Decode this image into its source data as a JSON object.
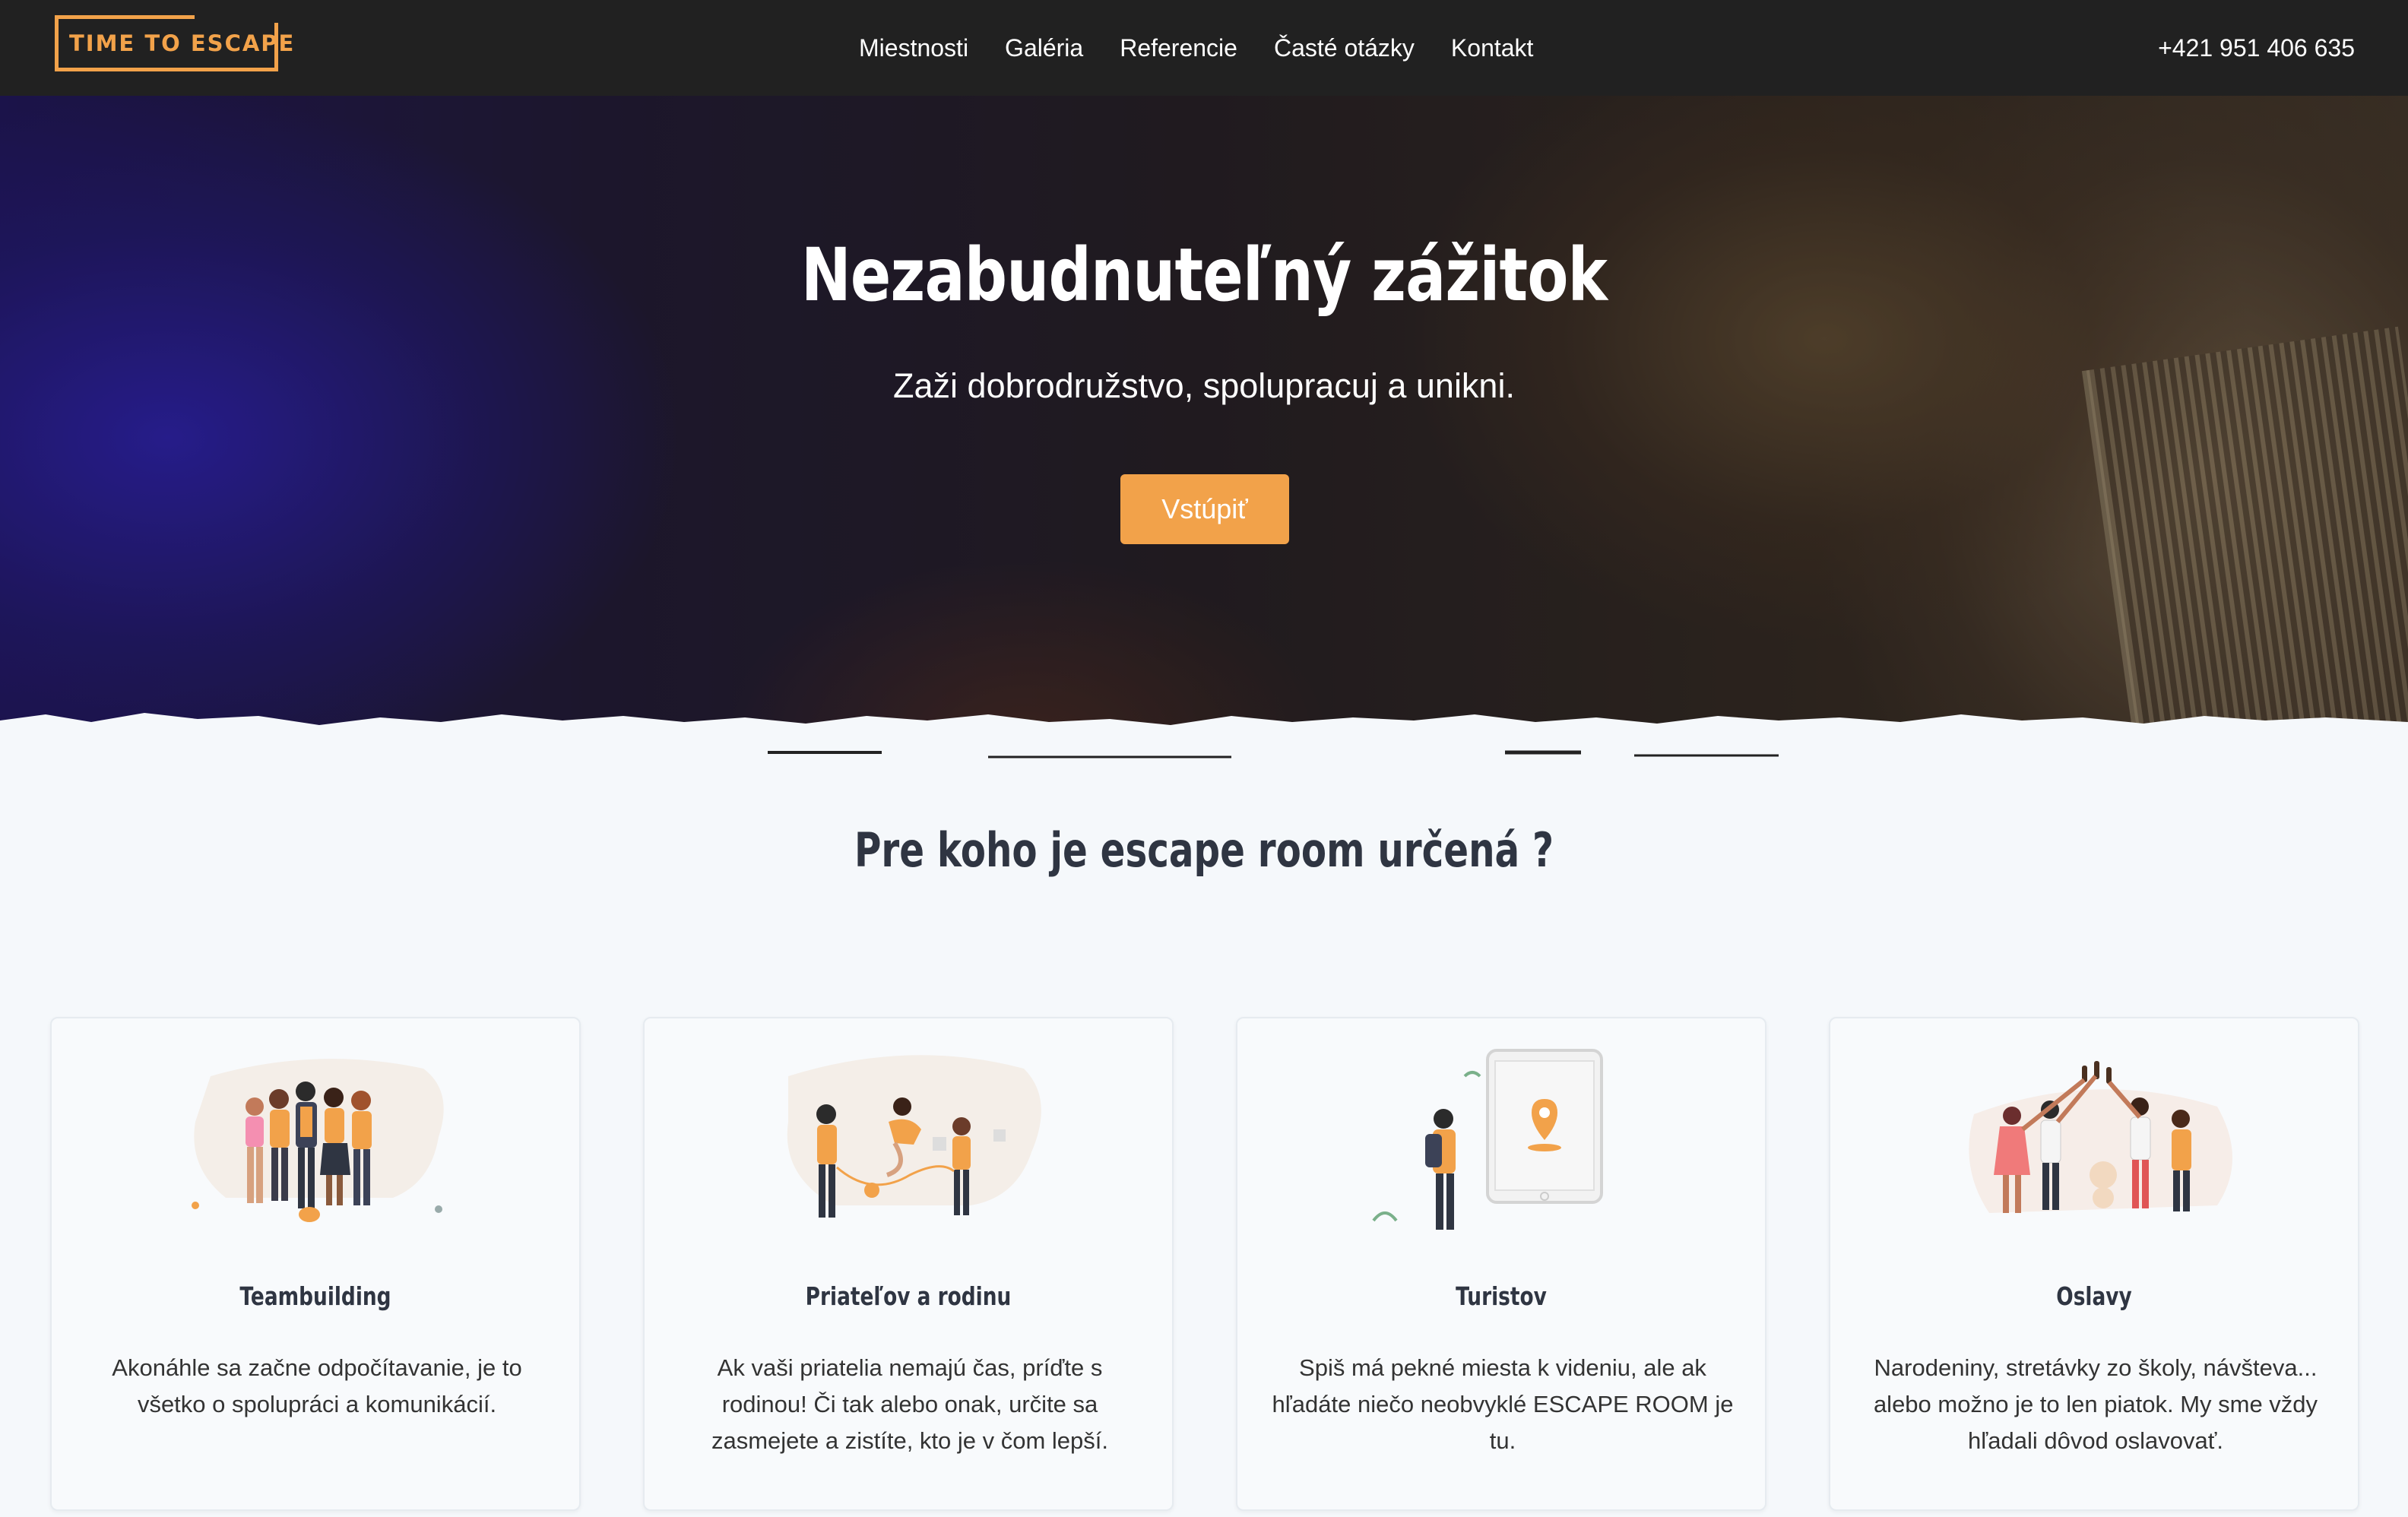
{
  "navbar": {
    "logo_text": "TIME TO ESCAPE",
    "links": [
      "Miestnosti",
      "Galéria",
      "Referencie",
      "Časté otázky",
      "Kontakt"
    ],
    "phone": "+421 951 406 635"
  },
  "hero": {
    "title": "Nezabudnuteľný zážitok",
    "subtitle": "Zaži dobrodružstvo, spolupracuj a unikni.",
    "button": "Vstúpiť"
  },
  "section": {
    "title": "Pre koho je escape room určená ?"
  },
  "cards": [
    {
      "title": "Teambuilding",
      "text": "Akonáhle sa začne odpočítavanie, je to všetko o spolupráci a komunikácií.",
      "icon": "team-illustration"
    },
    {
      "title": "Priateľov a rodinu",
      "text": "Ak vaši priatelia nemajú čas, príďte s rodinou! Či tak alebo onak, určite sa zasmejete a zistíte, kto je v čom lepší.",
      "icon": "family-illustration"
    },
    {
      "title": "Turistov",
      "text": "Spiš má pekné miesta k videniu, ale ak hľadáte niečo neobvyklé ESCAPE ROOM je tu.",
      "icon": "tourist-map-illustration"
    },
    {
      "title": "Oslavy",
      "text": "Narodeniny, stretávky zo školy, návšteva... alebo možno je to len piatok. My sme vždy hľadali dôvod oslavovať.",
      "icon": "party-illustration"
    }
  ],
  "colors": {
    "accent": "#f2a24a",
    "navbar": "#212121",
    "page_bg": "#f5f8fb",
    "text_dark": "#2f3542"
  }
}
